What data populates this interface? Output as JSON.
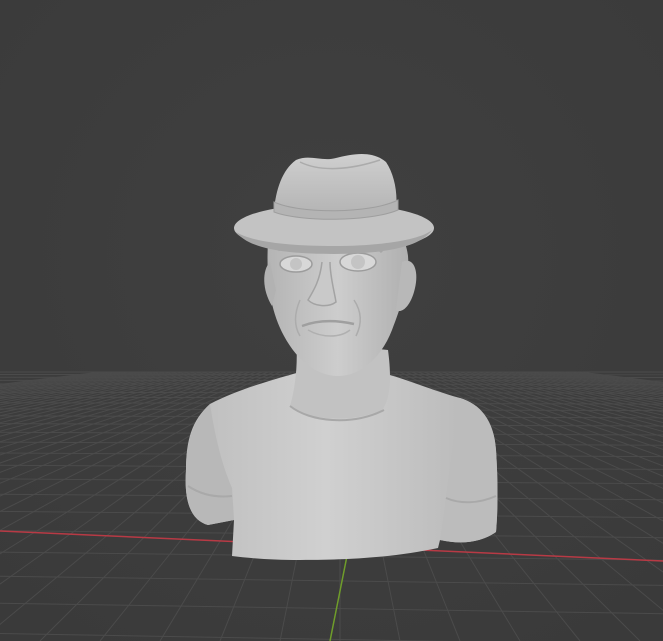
{
  "viewport": {
    "background": "#3d3d3d",
    "grid_color": "#4a4a4a",
    "x_axis_color": "#b83a45",
    "y_axis_color": "#6f9d2a"
  },
  "model": {
    "description_name": "bust-with-fedora",
    "clay_color": "#c7c7c7",
    "shade_color": "#9a9a9a",
    "highlight_color": "#dedede"
  }
}
